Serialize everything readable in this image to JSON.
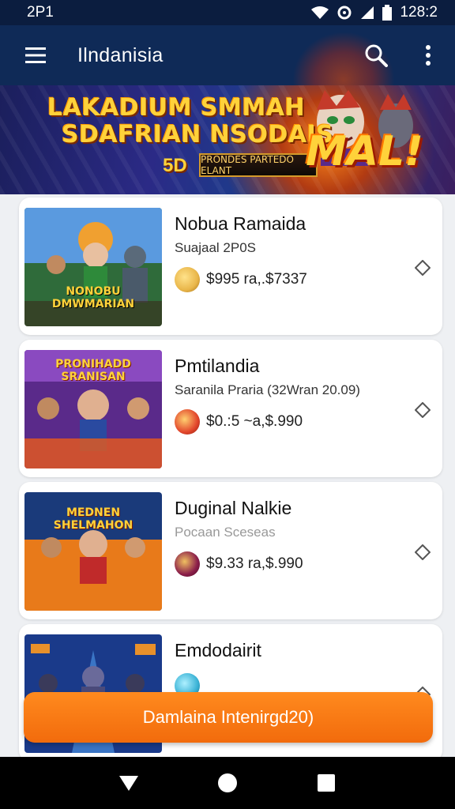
{
  "status_bar": {
    "time": "2P1",
    "clock": "128:2"
  },
  "app_bar": {
    "title": "Ilndanisia",
    "icons": [
      "menu-icon",
      "search-icon",
      "more-vert-icon"
    ]
  },
  "banner": {
    "headline_line1": "LAKADIUM SMMAH",
    "headline_line2": "SDAFRIAN NSODAIS",
    "badge": "5D",
    "tag": "PRONDES PARTEDO ELANT",
    "shout": "MAL!"
  },
  "games": [
    {
      "name": "Nobua Ramaida",
      "subtitle": "Suajaal 2P0S",
      "price": "$995 ra,.$7337",
      "art_title": "NONOBU DMWMARIAN",
      "coin_color": "#e9b64a"
    },
    {
      "name": "Pmtilandia",
      "subtitle": "Saranila Praria (32Wran 20.09)",
      "price": "$0.:5 ~a,$.990",
      "art_title": "PRONIHADD SRANISAN",
      "coin_color": "#e2462c"
    },
    {
      "name": "Duginal Nalkie",
      "subtitle": "Pocaan Sceseas",
      "price": "$9.33 ra,$.990",
      "art_title": "MEDNEN SHELMAHON",
      "coin_color": "#8b1e4a"
    },
    {
      "name": "Emdodairit",
      "subtitle": "",
      "price": "",
      "art_title": "",
      "coin_color": "#3bb3d6"
    }
  ],
  "cta": {
    "label": "Damlaina Intenirgd20)"
  },
  "colors": {
    "app_bar": "#0f2a57",
    "status_bar": "#0b1d3f",
    "cta": "#f47a14"
  }
}
